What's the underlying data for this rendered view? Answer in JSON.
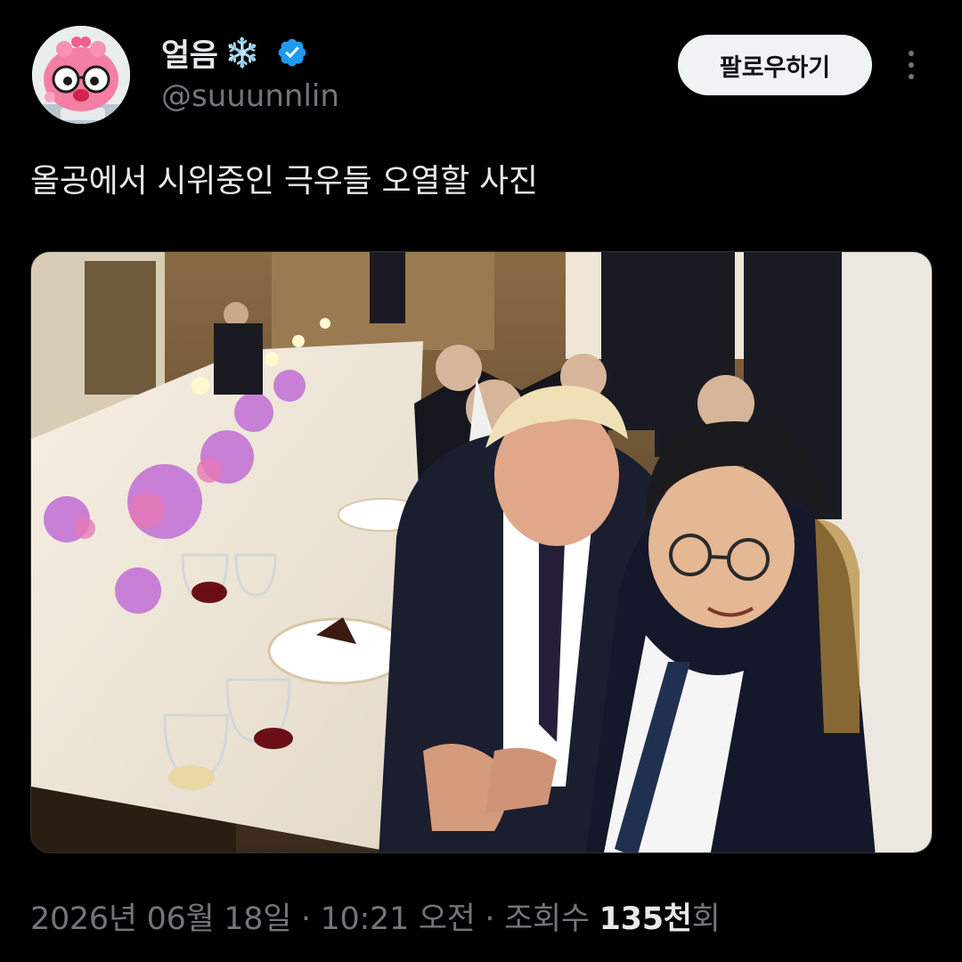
{
  "profile": {
    "display_name": "얼음",
    "snowflake": "❄️",
    "handle": "@suuunnlin",
    "verified": true
  },
  "actions": {
    "follow_label": "팔로우하기"
  },
  "tweet": {
    "text": "올공에서 시위중인 극우들 오열할 사진"
  },
  "meta": {
    "date": "2026년 06월 18일",
    "sep1": " · ",
    "time": "10:21 오전",
    "sep2": " · ",
    "views_prefix": "조회수 ",
    "views_count": "135천",
    "views_suffix": "회"
  },
  "colors": {
    "background": "#000000",
    "text_primary": "#e7e9ea",
    "text_secondary": "#71767b",
    "verified_blue": "#1d9bf0",
    "follow_bg": "#eff3f4"
  }
}
